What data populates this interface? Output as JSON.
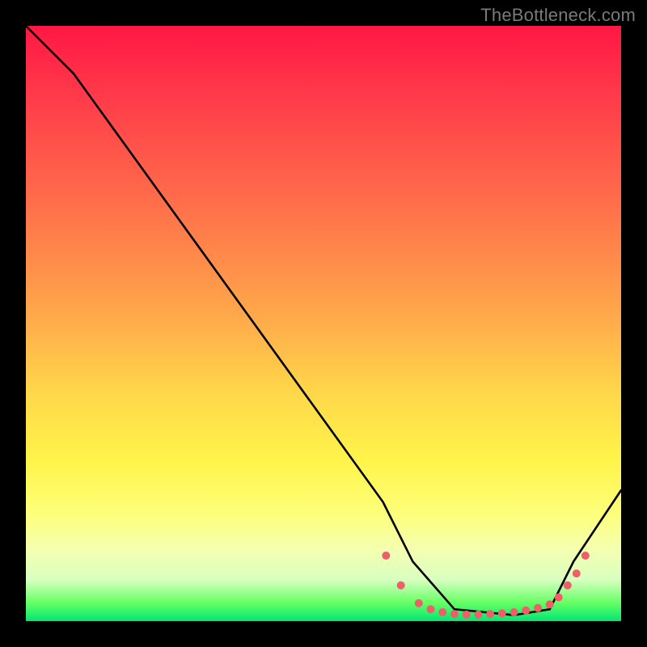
{
  "watermark": "TheBottleneck.com",
  "chart_data": {
    "type": "line",
    "title": "",
    "xlabel": "",
    "ylabel": "",
    "xlim": [
      0,
      100
    ],
    "ylim": [
      0,
      100
    ],
    "series": [
      {
        "name": "curve",
        "x": [
          0,
          8,
          60,
          65,
          72,
          82,
          88,
          92,
          100
        ],
        "y": [
          100,
          92,
          20,
          10,
          2,
          1,
          2,
          10,
          22
        ]
      }
    ],
    "markers": {
      "name": "highlight-points",
      "color": "#ef5f6a",
      "x": [
        60.5,
        63,
        66,
        68,
        70,
        72,
        74,
        76,
        78,
        80,
        82,
        84,
        86,
        88,
        89.5,
        91,
        92.5,
        94
      ],
      "y": [
        11,
        6,
        3,
        2,
        1.5,
        1.2,
        1.1,
        1.1,
        1.2,
        1.3,
        1.5,
        1.8,
        2.2,
        2.8,
        4,
        6,
        8,
        11
      ]
    }
  }
}
